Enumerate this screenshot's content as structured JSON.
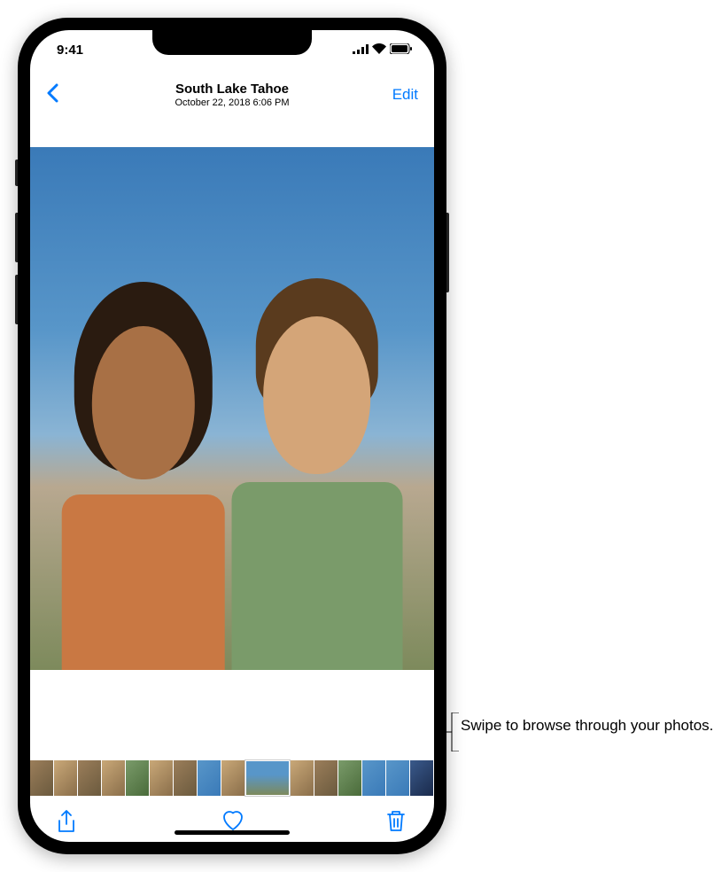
{
  "status_bar": {
    "time": "9:41"
  },
  "nav": {
    "title": "South Lake Tahoe",
    "subtitle": "October 22, 2018  6:06 PM",
    "edit_label": "Edit"
  },
  "toolbar": {
    "share_name": "share-icon",
    "favorite_name": "heart-icon",
    "delete_name": "trash-icon"
  },
  "callout": {
    "text": "Swipe to browse through your photos."
  }
}
